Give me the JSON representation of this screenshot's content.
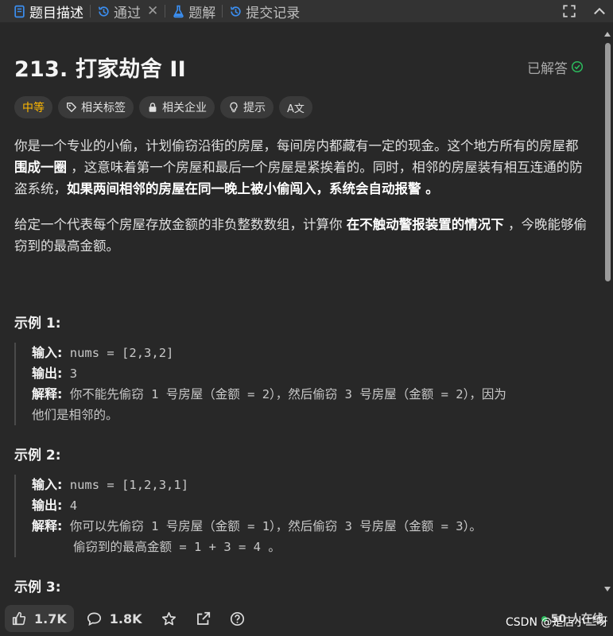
{
  "tabs": [
    {
      "label": "题目描述",
      "icon": "description-icon",
      "active": true
    },
    {
      "label": "通过",
      "icon": "history-icon",
      "active": false
    },
    {
      "label": "题解",
      "icon": "flask-icon",
      "active": false
    },
    {
      "label": "提交记录",
      "icon": "history-icon",
      "active": false
    }
  ],
  "problem": {
    "title": "213. 打家劫舍 II",
    "status": "已解答"
  },
  "tags": {
    "difficulty": "中等",
    "related_tags": "相关标签",
    "related_companies": "相关企业",
    "hint": "提示",
    "translate": "A文"
  },
  "description": {
    "p1_a": "你是一个专业的小偷，计划偷窃沿街的房屋，每间房内都藏有一定的现金。这个地方所有的房屋都 ",
    "p1_b": "围成一圈",
    "p1_c": " ，这意味着第一个房屋和最后一个房屋是紧挨着的。同时，相邻的房屋装有相互连通的防盗系统，",
    "p1_d": "如果两间相邻的房屋在同一晚上被小偷闯入，系统会自动报警",
    "p1_e": " 。",
    "p2_a": "给定一个代表每个房屋存放金额的非负整数数组，计算你 ",
    "p2_b": "在不触动警报装置的情况下",
    "p2_c": " ，今晚能够偷窃到的最高金额。"
  },
  "examples": [
    {
      "title": "示例 1:",
      "input_label": "输入:",
      "input": " nums = [2,3,2]",
      "output_label": "输出:",
      "output": " 3",
      "explain_label": "解释:",
      "explain_1": " 你不能先偷窃 1 号房屋（金额 = 2），然后偷窃 3 号房屋（金额 = 2），因为",
      "explain_2": "他们是相邻的。"
    },
    {
      "title": "示例 2:",
      "input_label": "输入:",
      "input": " nums = [1,2,3,1]",
      "output_label": "输出:",
      "output": " 4",
      "explain_label": "解释:",
      "explain_1": " 你可以先偷窃 1 号房屋（金额 = 1），然后偷窃 3 号房屋（金额 = 3）。",
      "explain_2": "偷窃到的最高金额 = 1 + 3 = 4 。"
    },
    {
      "title": "示例 3:"
    }
  ],
  "bottom": {
    "likes": "1.7K",
    "comments": "1.8K",
    "online": "50 人在线",
    "watermark": "CSDN @是店小二呀"
  },
  "colors": {
    "background": "#282828",
    "difficulty": "#ffb800",
    "solved_check": "#2cbb5d",
    "online_dot": "#2cbb5d"
  }
}
